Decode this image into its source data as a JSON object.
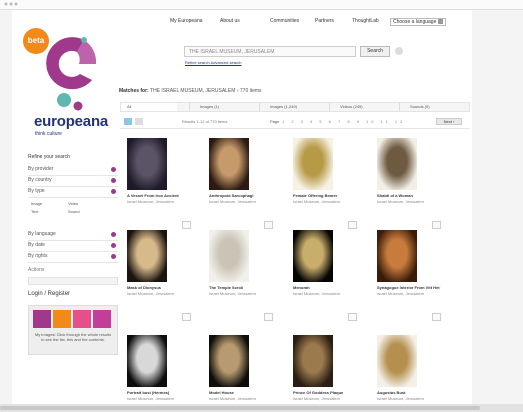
{
  "logo": {
    "beta_badge": "beta",
    "wordmark": "europeana",
    "tagline": "think culture",
    "colors": {
      "magenta": "#a0398c",
      "orange": "#f28a1a",
      "teal": "#5fb7b0",
      "navy": "#21327a"
    }
  },
  "topnav": {
    "items": [
      "My Europeana",
      "About us",
      "Communities",
      "Partners",
      "ThoughtLab"
    ],
    "language_select": "Choose a language"
  },
  "search": {
    "value": "THE ISRAEL MUSEUM, JERUSALEM",
    "button_label": "Search",
    "links": "Refine search  Advanced search"
  },
  "breadcrumb": {
    "label": "Matches for:",
    "value": "THE ISRAEL MUSEUM, JERUSALEM  ›  770 items"
  },
  "sidebar": {
    "title": "Refine your search",
    "filters_top": [
      "By provider",
      "By country",
      "By type"
    ],
    "types": [
      "Image",
      "Video",
      "Text",
      "Sound"
    ],
    "filters_bottom": [
      "By language",
      "By date",
      "By rights"
    ],
    "actions_label": "Actions",
    "login_label": "Login / Register",
    "promo_text": "My Images! Click through the whole results to see the list, this and the contents."
  },
  "tabs": [
    "All",
    "Images (1)",
    "Images (1,249)",
    "Videos (249)",
    "Sounds (0)"
  ],
  "toolbar": {
    "count_text": "Results 1-12 of 770 items",
    "page_label": "Page",
    "pages": "1 2 3 4 5 6 7 8 9 10 11 12",
    "next_label": "Next ›"
  },
  "results": [
    {
      "title": "A Vessel From Iron Ancient",
      "meta": "Israel Museum, Jerusalem",
      "colors": [
        "#1f1a2a",
        "#5a5466"
      ]
    },
    {
      "title": "Anthropoid Sarcophagi",
      "meta": "Israel Museum, Jerusalem",
      "colors": [
        "#2c1a12",
        "#c69a6a"
      ]
    },
    {
      "title": "Female Offering Bearer",
      "meta": "Israel Museum, Jerusalem",
      "colors": [
        "#f6f1e3",
        "#b79a45"
      ]
    },
    {
      "title": "Shabti of a Woman",
      "meta": "Israel Museum, Jerusalem",
      "colors": [
        "#f3efe6",
        "#6e5a40"
      ]
    },
    {
      "title": "Mask of Dionysus",
      "meta": "Israel Museum, Jerusalem",
      "colors": [
        "#1a1410",
        "#d8b98a"
      ]
    },
    {
      "title": "The Temple Scroll",
      "meta": "Israel Museum, Jerusalem",
      "colors": [
        "#f2f0ea",
        "#c9c4b6"
      ]
    },
    {
      "title": "Menorah",
      "meta": "Israel Museum, Jerusalem",
      "colors": [
        "#050505",
        "#c9ad6a"
      ]
    },
    {
      "title": "Synagogue Interior From Vitt Het Wiel",
      "meta": "Israel Museum, Jerusalem",
      "colors": [
        "#3b1c0a",
        "#c77b3c"
      ]
    },
    {
      "title": "Portrait bust (Hermes)",
      "meta": "Israel Museum, Jerusalem",
      "colors": [
        "#0d0d0d",
        "#d8d8d8"
      ]
    },
    {
      "title": "Model House",
      "meta": "Israel Museum, Jerusalem",
      "colors": [
        "#0e0d0a",
        "#b89a70"
      ]
    },
    {
      "title": "Prince Of Goddess Plaque",
      "meta": "Israel Museum, Jerusalem",
      "colors": [
        "#2a1d12",
        "#9b7a4e"
      ]
    },
    {
      "title": "Augustus Bust",
      "meta": "Israel Museum, Jerusalem",
      "colors": [
        "#f4f0e8",
        "#b58f4e"
      ]
    }
  ]
}
